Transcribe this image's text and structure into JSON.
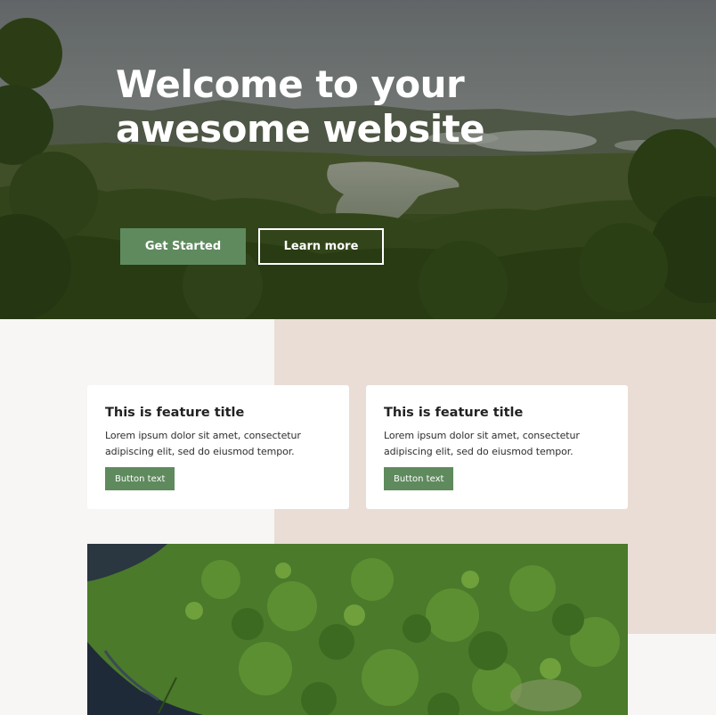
{
  "hero": {
    "title": "Welcome to your awesome website",
    "primary_button": "Get Started",
    "secondary_button": "Learn more"
  },
  "features": [
    {
      "title": "This is feature title",
      "text": "Lorem ipsum dolor sit amet, consectetur adipiscing elit, sed do eiusmod tempor.",
      "button": "Button text"
    },
    {
      "title": "This is feature title",
      "text": "Lorem ipsum dolor sit amet, consectetur adipiscing elit, sed do eiusmod tempor.",
      "button": "Button text"
    }
  ],
  "colors": {
    "accent_green": "#5f8a5e",
    "beige_panel": "#e9ddd5",
    "page_background": "#f7f6f4"
  }
}
